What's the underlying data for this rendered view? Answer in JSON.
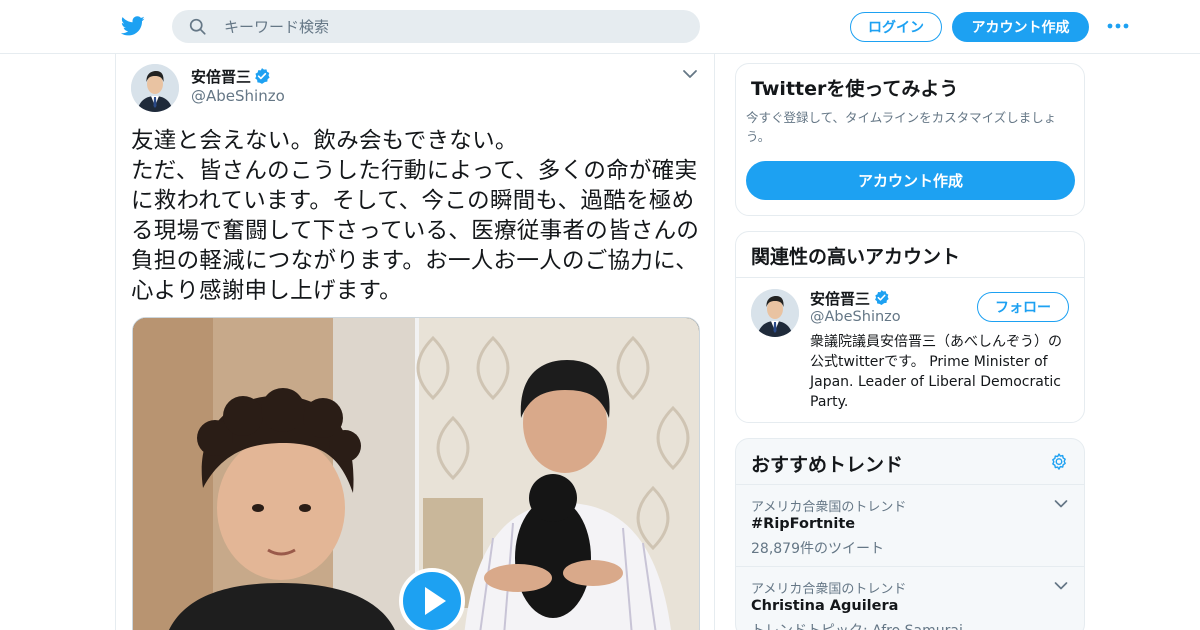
{
  "header": {
    "search_placeholder": "キーワード検索",
    "login_label": "ログイン",
    "signup_label": "アカウント作成",
    "brand_color": "#1da1f2"
  },
  "tweet": {
    "author_name": "安倍晋三",
    "author_handle": "@AbeShinzo",
    "verified": true,
    "text": "友達と会えない。飲み会もできない。\nただ、皆さんのこうした行動によって、多くの命が確実に救われています。そして、今この瞬間も、過酷を極める現場で奮闘して下さっている、医療従事者の皆さんの負担の軽減につながります。お一人お一人のご協力に、心より感謝申し上げます。",
    "media_type": "video"
  },
  "sidebar": {
    "signup_card": {
      "title": "Twitterを使ってみよう",
      "subtitle": "今すぐ登録して、タイムラインをカスタマイズしましょう。",
      "button_label": "アカウント作成"
    },
    "related_card": {
      "title": "関連性の高いアカウント",
      "account_name": "安倍晋三",
      "account_handle": "@AbeShinzo",
      "follow_label": "フォロー",
      "bio": "衆議院議員安倍晋三（あべしんぞう）の公式twitterです。 Prime Minister of Japan. Leader of Liberal Democratic Party."
    },
    "trends_card": {
      "title": "おすすめトレンド",
      "items": [
        {
          "context": "アメリカ合衆国のトレンド",
          "name": "#RipFortnite",
          "meta": "28,879件のツイート"
        },
        {
          "context": "アメリカ合衆国のトレンド",
          "name": "Christina Aguilera",
          "meta": "トレンドトピック: Afro Samurai"
        }
      ]
    }
  }
}
